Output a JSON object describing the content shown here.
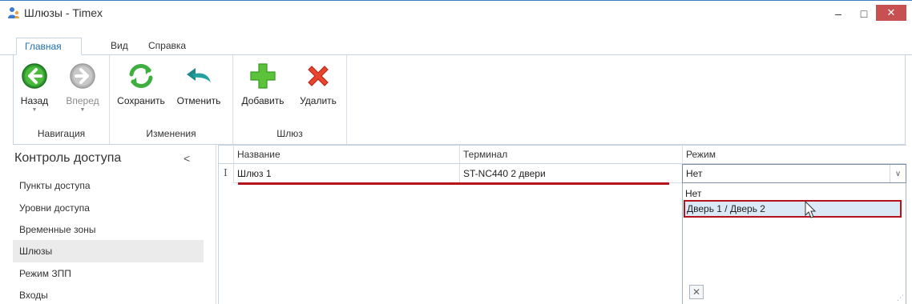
{
  "window": {
    "title": "Шлюзы - Timex",
    "minimize_glyph": "–",
    "maximize_glyph": "□",
    "close_glyph": "✕"
  },
  "ribbon": {
    "tabs": [
      {
        "label": "Главная",
        "active": true
      },
      {
        "label": "Вид",
        "active": false
      },
      {
        "label": "Справка",
        "active": false
      }
    ],
    "groups": {
      "navigation": {
        "label": "Навигация",
        "back": {
          "label": "Назад",
          "icon": "arrow-left-icon"
        },
        "forward": {
          "label": "Вперед",
          "icon": "arrow-right-icon",
          "disabled": true
        }
      },
      "changes": {
        "label": "Изменения",
        "save": {
          "label": "Сохранить",
          "icon": "refresh-icon"
        },
        "cancel": {
          "label": "Отменить",
          "icon": "undo-icon"
        }
      },
      "gateway": {
        "label": "Шлюз",
        "add": {
          "label": "Добавить",
          "icon": "plus-icon"
        },
        "delete": {
          "label": "Удалить",
          "icon": "delete-x-icon"
        }
      }
    }
  },
  "navpanel": {
    "title": "Контроль доступа",
    "collapse_glyph": "<",
    "items": [
      {
        "label": "Пункты доступа",
        "selected": false
      },
      {
        "label": "Уровни доступа",
        "selected": false
      },
      {
        "label": "Временные зоны",
        "selected": false
      },
      {
        "label": "Шлюзы",
        "selected": true
      },
      {
        "label": "Режим ЗПП",
        "selected": false
      },
      {
        "label": "Входы",
        "selected": false
      }
    ]
  },
  "grid": {
    "columns": [
      "Название",
      "Терминал",
      "Режим"
    ],
    "rows": [
      {
        "indicator": "I",
        "name": "Шлюз 1",
        "terminal": "ST-NC440 2 двери",
        "mode": "Нет"
      }
    ],
    "mode_dropdown": {
      "options": [
        "Нет",
        "Дверь 1 / Дверь 2"
      ],
      "highlighted": "Дверь 1 / Дверь 2",
      "clear_glyph": "✕",
      "open_glyph": "∨"
    }
  },
  "colors": {
    "accent_red": "#b5121b",
    "highlight_blue": "#dbe8f6",
    "tab_active": "#1f6fb2",
    "close_button": "#c75050"
  }
}
